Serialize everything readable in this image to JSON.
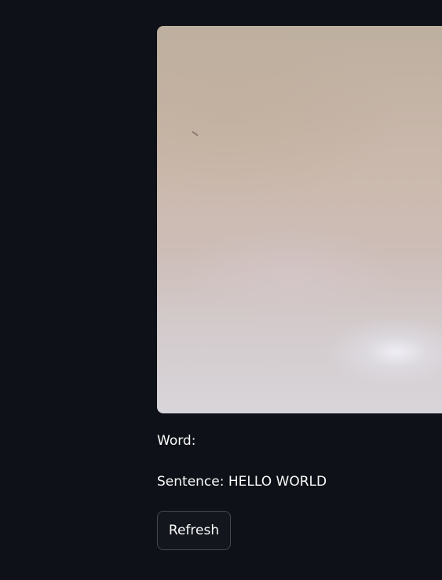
{
  "camera": {
    "feed_name": "webcam-frame"
  },
  "output": {
    "word_label": "Word:",
    "word_value": "",
    "sentence_label": "Sentence:",
    "sentence_value": "HELLO WORLD"
  },
  "controls": {
    "refresh_label": "Refresh"
  },
  "colors": {
    "background": "#0e1117",
    "text": "#fafafa",
    "button_border": "#3a3d44"
  }
}
